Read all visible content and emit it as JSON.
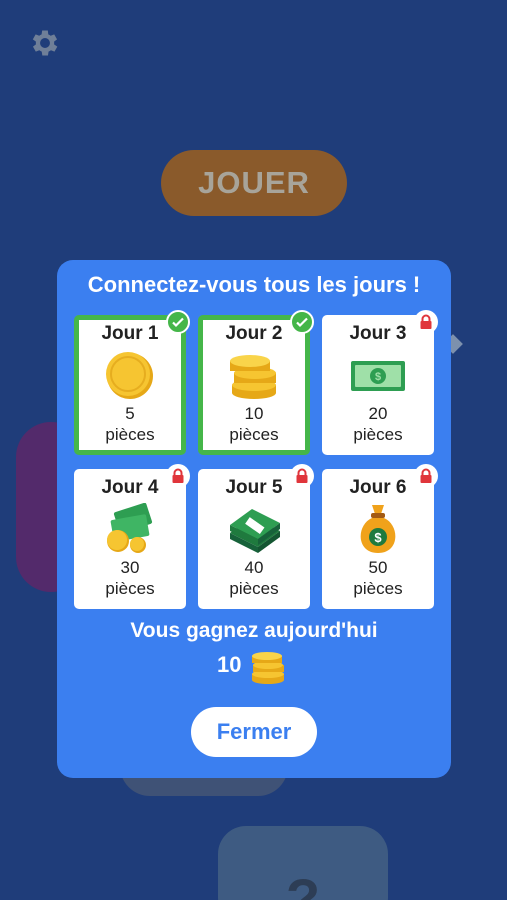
{
  "background": {
    "settings_icon": "gear-icon",
    "play_label": "JOUER",
    "card_glyph": "?"
  },
  "dialog": {
    "title": "Connectez-vous tous les jours !",
    "days": [
      {
        "label": "Jour 1",
        "amount": "5",
        "unit": "pièces",
        "status": "claimed",
        "icon": "coin-icon"
      },
      {
        "label": "Jour 2",
        "amount": "10",
        "unit": "pièces",
        "status": "claimed",
        "icon": "coin-stack-icon"
      },
      {
        "label": "Jour 3",
        "amount": "20",
        "unit": "pièces",
        "status": "locked",
        "icon": "banknote-icon"
      },
      {
        "label": "Jour 4",
        "amount": "30",
        "unit": "pièces",
        "status": "locked",
        "icon": "cash-and-coins-icon"
      },
      {
        "label": "Jour 5",
        "amount": "40",
        "unit": "pièces",
        "status": "locked",
        "icon": "cash-stack-icon"
      },
      {
        "label": "Jour 6",
        "amount": "50",
        "unit": "pièces",
        "status": "locked",
        "icon": "money-bag-icon"
      }
    ],
    "today_text": "Vous gagnez aujourd'hui",
    "today_amount": "10",
    "close_label": "Fermer"
  },
  "colors": {
    "background": "#1f3d7a",
    "dialog": "#3b7ff0",
    "claimed": "#45b649",
    "lock": "#e0353b"
  }
}
